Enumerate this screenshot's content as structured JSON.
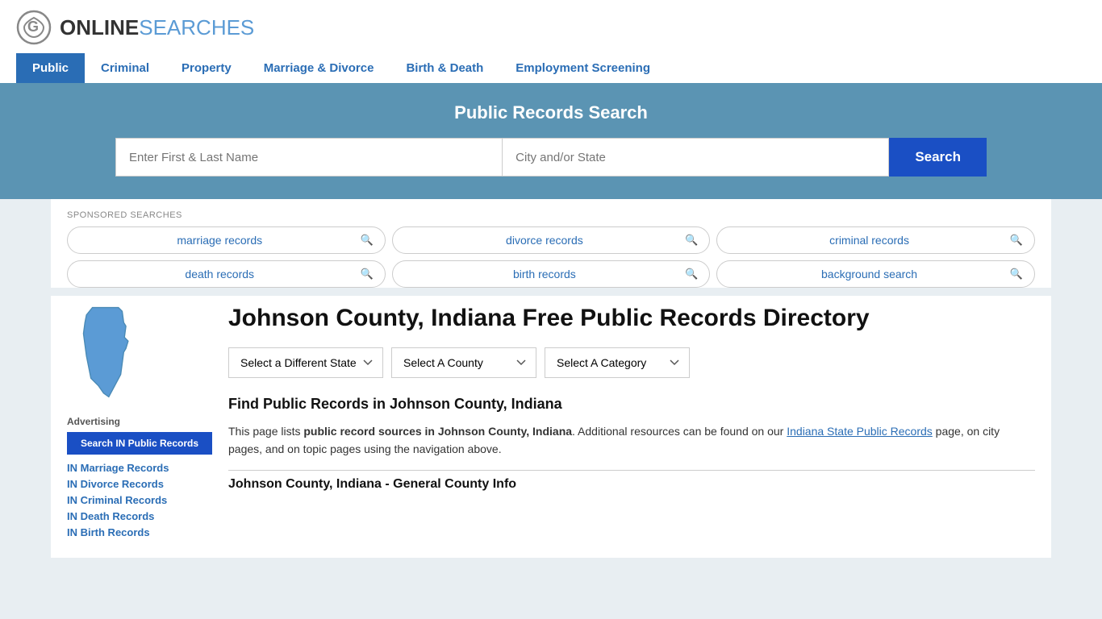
{
  "logo": {
    "online": "ONLINE",
    "searches": "SEARCHES"
  },
  "nav": {
    "items": [
      {
        "label": "Public",
        "active": true
      },
      {
        "label": "Criminal",
        "active": false
      },
      {
        "label": "Property",
        "active": false
      },
      {
        "label": "Marriage & Divorce",
        "active": false
      },
      {
        "label": "Birth & Death",
        "active": false
      },
      {
        "label": "Employment Screening",
        "active": false
      }
    ]
  },
  "search_banner": {
    "title": "Public Records Search",
    "name_placeholder": "Enter First & Last Name",
    "location_placeholder": "City and/or State",
    "button_label": "Search"
  },
  "sponsored": {
    "label": "SPONSORED SEARCHES",
    "items": [
      {
        "label": "marriage records"
      },
      {
        "label": "divorce records"
      },
      {
        "label": "criminal records"
      },
      {
        "label": "death records"
      },
      {
        "label": "birth records"
      },
      {
        "label": "background search"
      }
    ]
  },
  "sidebar": {
    "ad_label": "Advertising",
    "ad_button": "Search IN Public Records",
    "links": [
      {
        "label": "IN Marriage Records"
      },
      {
        "label": "IN Divorce Records"
      },
      {
        "label": "IN Criminal Records"
      },
      {
        "label": "IN Death Records"
      },
      {
        "label": "IN Birth Records"
      }
    ]
  },
  "main": {
    "page_title": "Johnson County, Indiana Free Public Records Directory",
    "dropdowns": {
      "state": "Select a Different State",
      "county": "Select A County",
      "category": "Select A Category"
    },
    "find_title": "Find Public Records in Johnson County, Indiana",
    "description_part1": "This page lists ",
    "description_bold": "public record sources in Johnson County, Indiana",
    "description_part2": ". Additional resources can be found on our ",
    "description_link": "Indiana State Public Records",
    "description_end": " page, on city pages, and on topic pages using the navigation above.",
    "county_info_title": "Johnson County, Indiana - General County Info"
  }
}
